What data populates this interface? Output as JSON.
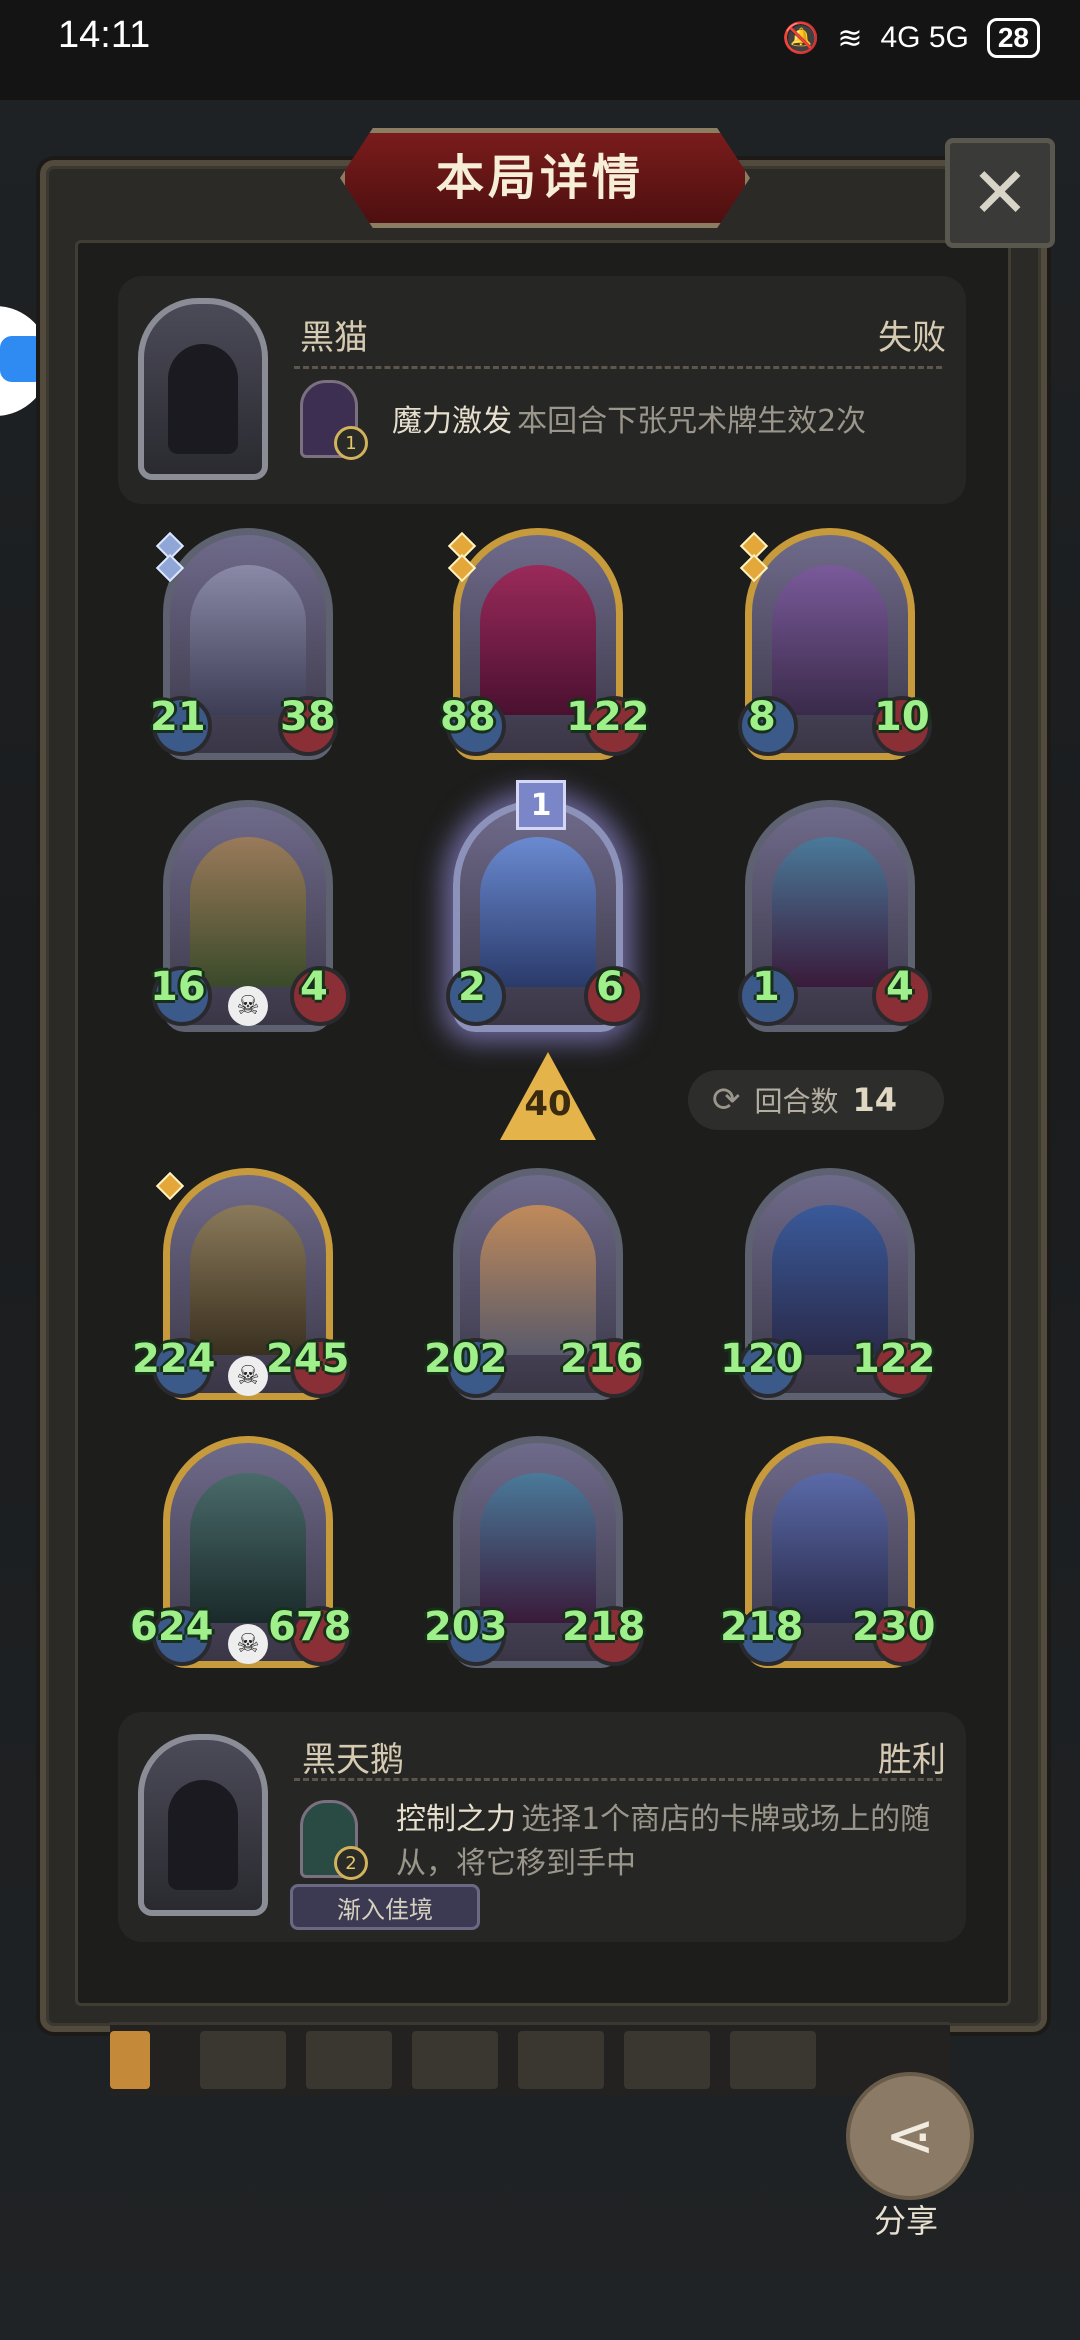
{
  "status_bar": {
    "time": "14:11",
    "network": "4G 5G",
    "battery": "28"
  },
  "dialog": {
    "title": "本局详情",
    "close_icon": "close-icon"
  },
  "opponent": {
    "name": "黑猫",
    "result": "失败",
    "skill": {
      "level": "1",
      "name": "魔力激发",
      "description": "本回合下张咒术牌生效2次"
    }
  },
  "opponent_board": [
    {
      "atk": "21",
      "hp": "38"
    },
    {
      "atk": "88",
      "hp": "122"
    },
    {
      "atk": "8",
      "hp": "10"
    },
    {
      "atk": "16",
      "hp": "4"
    },
    {
      "atk": "2",
      "hp": "6",
      "level": "1"
    },
    {
      "atk": "1",
      "hp": "4"
    }
  ],
  "tier": "40",
  "round": {
    "label": "回合数",
    "value": "14"
  },
  "player_board": [
    {
      "atk": "224",
      "hp": "245"
    },
    {
      "atk": "202",
      "hp": "216"
    },
    {
      "atk": "120",
      "hp": "122"
    },
    {
      "atk": "624",
      "hp": "678"
    },
    {
      "atk": "203",
      "hp": "218"
    },
    {
      "atk": "218",
      "hp": "230"
    }
  ],
  "player": {
    "name": "黑天鹅",
    "result": "胜利",
    "skill": {
      "level": "2",
      "name": "控制之力",
      "description_line1": "选择1个商店的卡牌或场上的随",
      "description_line2": "从，将它移到手中"
    },
    "tag": "渐入佳境"
  },
  "share": {
    "label": "分享"
  }
}
